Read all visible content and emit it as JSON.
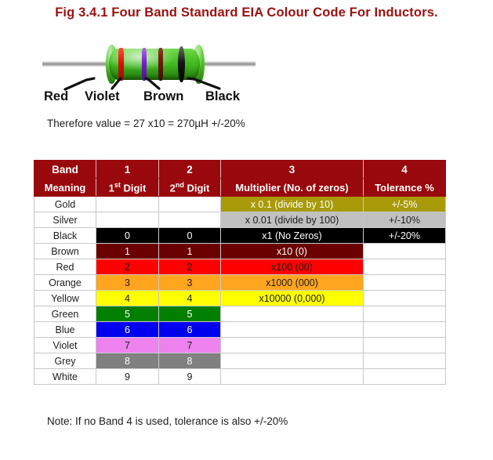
{
  "figure": {
    "title": "Fig 3.4.1 Four Band Standard EIA Colour Code For Inductors.",
    "title_color": "#9B1111",
    "band_labels": [
      "Red",
      "Violet",
      "Brown",
      "Black"
    ],
    "body_color": "#3FB81D",
    "band_colors": [
      "#E01000",
      "#7A1ED2",
      "#6B1A06",
      "#000000"
    ],
    "therefore_text": "Therefore value = 27 x10 = 270µH +/-20%"
  },
  "note": "Note: If no Band 4 is used, tolerance is also +/-20%",
  "table": {
    "header_bg": "#99080C",
    "header_rows": [
      {
        "label": "Band",
        "cols": [
          "1",
          "2",
          "3",
          "4"
        ]
      },
      {
        "label": "Meaning",
        "digit1": "1",
        "digit1_sup": "st",
        "digit1_rest": " Digit",
        "digit2": "2",
        "digit2_sup": "nd",
        "digit2_rest": " Digit",
        "multiplier": "Multiplier (No. of zeros)",
        "tolerance": "Tolerance %"
      }
    ],
    "rows": [
      {
        "name": "Gold",
        "digit1": "",
        "digit2": "",
        "multiplier": "x 0.1 (divide by 10)",
        "tolerance": "+/-5%",
        "bg": "#A89A08",
        "fg": "#ffffff",
        "colored": "mult-tol"
      },
      {
        "name": "Silver",
        "digit1": "",
        "digit2": "",
        "multiplier": "x 0.01 (divide by 100)",
        "tolerance": "+/-10%",
        "bg": "#C0C0C0",
        "fg": "#1d1d1d",
        "colored": "mult-tol"
      },
      {
        "name": "Black",
        "digit1": "0",
        "digit2": "0",
        "multiplier": "x1 (No Zeros)",
        "tolerance": "+/-20%",
        "bg": "#000000",
        "fg": "#ffffff",
        "colored": "all"
      },
      {
        "name": "Brown",
        "digit1": "1",
        "digit2": "1",
        "multiplier": "x10 (0)",
        "tolerance": "",
        "bg": "#6B0000",
        "fg": "#ffffff",
        "colored": "digits-mult"
      },
      {
        "name": "Red",
        "digit1": "2",
        "digit2": "2",
        "multiplier": "x100 (00)",
        "tolerance": "",
        "bg": "#FF0000",
        "fg": "#1d1d1d",
        "colored": "digits-mult"
      },
      {
        "name": "Orange",
        "digit1": "3",
        "digit2": "3",
        "multiplier": "x1000 (000)",
        "tolerance": "",
        "bg": "#FFA51E",
        "fg": "#1d1d1d",
        "colored": "digits-mult"
      },
      {
        "name": "Yellow",
        "digit1": "4",
        "digit2": "4",
        "multiplier": "x10000 (0,000)",
        "tolerance": "",
        "bg": "#FFFF00",
        "fg": "#1d1d1d",
        "colored": "digits-mult"
      },
      {
        "name": "Green",
        "digit1": "5",
        "digit2": "5",
        "multiplier": "",
        "tolerance": "",
        "bg": "#007F00",
        "fg": "#ffffff",
        "colored": "digits"
      },
      {
        "name": "Blue",
        "digit1": "6",
        "digit2": "6",
        "multiplier": "",
        "tolerance": "",
        "bg": "#0000EE",
        "fg": "#ffffff",
        "colored": "digits"
      },
      {
        "name": "Violet",
        "digit1": "7",
        "digit2": "7",
        "multiplier": "",
        "tolerance": "",
        "bg": "#EE82EE",
        "fg": "#1d1d1d",
        "colored": "digits"
      },
      {
        "name": "Grey",
        "digit1": "8",
        "digit2": "8",
        "multiplier": "",
        "tolerance": "",
        "bg": "#808080",
        "fg": "#ffffff",
        "colored": "digits"
      },
      {
        "name": "White",
        "digit1": "9",
        "digit2": "9",
        "multiplier": "",
        "tolerance": "",
        "bg": "#FFFFFF",
        "fg": "#1d1d1d",
        "colored": "digits"
      }
    ]
  }
}
